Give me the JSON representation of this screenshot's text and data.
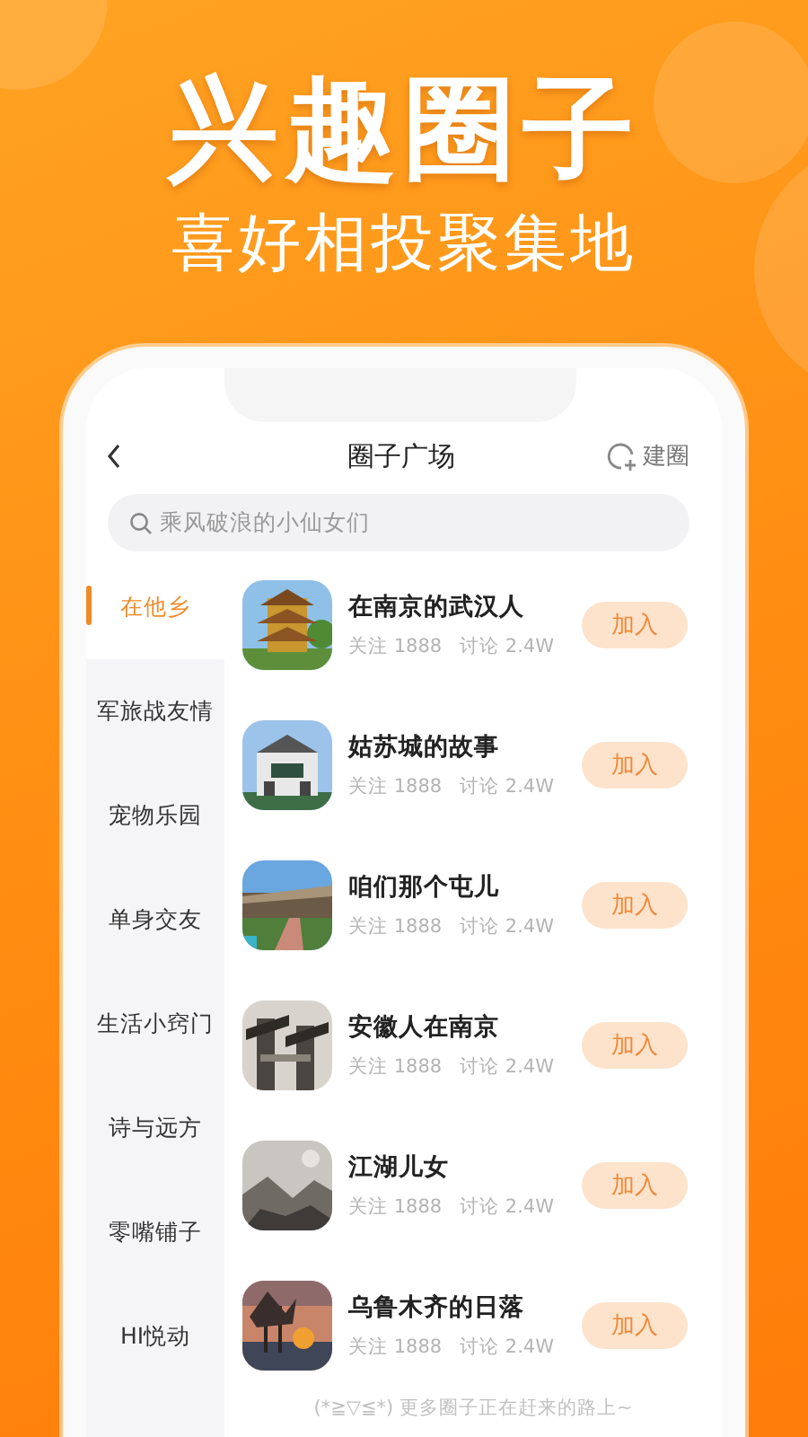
{
  "hero": {
    "title": "兴趣圈子",
    "subtitle": "喜好相投聚集地"
  },
  "header": {
    "title": "圈子广场",
    "create_label": "建圈"
  },
  "search": {
    "placeholder": "乘风破浪的小仙女们"
  },
  "categories": [
    {
      "label": "在他乡",
      "selected": true
    },
    {
      "label": "军旅战友情",
      "selected": false
    },
    {
      "label": "宠物乐园",
      "selected": false
    },
    {
      "label": "单身交友",
      "selected": false
    },
    {
      "label": "生活小窍门",
      "selected": false
    },
    {
      "label": "诗与远方",
      "selected": false
    },
    {
      "label": "零嘴铺子",
      "selected": false
    },
    {
      "label": "HI悦动",
      "selected": false
    }
  ],
  "circles": [
    {
      "name": "在南京的武汉人",
      "follow": "关注 1888",
      "discuss": "讨论 2.4W",
      "button": "加入"
    },
    {
      "name": "姑苏城的故事",
      "follow": "关注 1888",
      "discuss": "讨论 2.4W",
      "button": "加入"
    },
    {
      "name": "咱们那个屯儿",
      "follow": "关注 1888",
      "discuss": "讨论 2.4W",
      "button": "加入"
    },
    {
      "name": "安徽人在南京",
      "follow": "关注 1888",
      "discuss": "讨论 2.4W",
      "button": "加入"
    },
    {
      "name": "江湖儿女",
      "follow": "关注 1888",
      "discuss": "讨论 2.4W",
      "button": "加入"
    },
    {
      "name": "乌鲁木齐的日落",
      "follow": "关注 1888",
      "discuss": "讨论 2.4W",
      "button": "加入"
    }
  ],
  "footer": "(*≧▽≦*) 更多圈子正在赶来的路上~"
}
